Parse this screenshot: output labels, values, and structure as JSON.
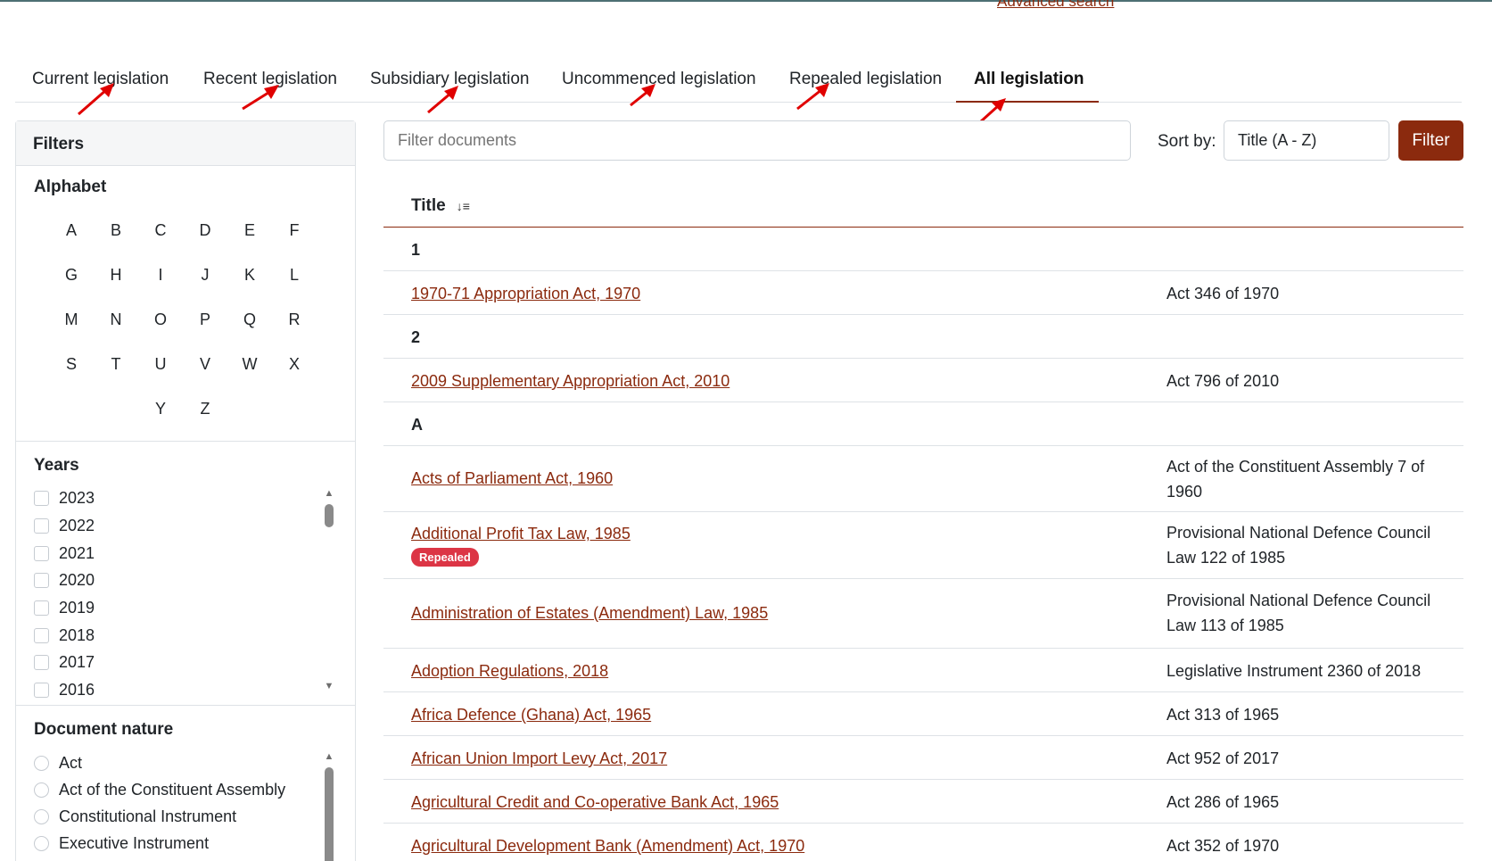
{
  "header": {
    "advanced_search": "Advanced search"
  },
  "tabs": [
    {
      "label": "Current legislation"
    },
    {
      "label": "Recent legislation"
    },
    {
      "label": "Subsidiary legislation"
    },
    {
      "label": "Uncommenced legislation"
    },
    {
      "label": "Repealed legislation"
    },
    {
      "label": "All legislation",
      "active": true
    }
  ],
  "filters": {
    "title": "Filters",
    "alphabet_title": "Alphabet",
    "letters": [
      "A",
      "B",
      "C",
      "D",
      "E",
      "F",
      "G",
      "H",
      "I",
      "J",
      "K",
      "L",
      "M",
      "N",
      "O",
      "P",
      "Q",
      "R",
      "S",
      "T",
      "U",
      "V",
      "W",
      "X",
      "Y",
      "Z"
    ],
    "years_title": "Years",
    "years": [
      "2023",
      "2022",
      "2021",
      "2020",
      "2019",
      "2018",
      "2017",
      "2016"
    ],
    "nature_title": "Document nature",
    "natures": [
      "Act",
      "Act of the Constituent Assembly",
      "Constitutional Instrument",
      "Executive Instrument"
    ]
  },
  "toolbar": {
    "search_placeholder": "Filter documents",
    "sort_label": "Sort by:",
    "sort_value": "Title (A - Z)",
    "filter_button": "Filter"
  },
  "table": {
    "title_header": "Title",
    "groups": {
      "g1": "1",
      "g2": "2",
      "gA": "A"
    },
    "rows": [
      {
        "title": "1970-71 Appropriation Act, 1970",
        "citation": "Act 346 of 1970"
      },
      {
        "title": "2009 Supplementary Appropriation Act, 2010",
        "citation": "Act 796 of 2010"
      },
      {
        "title": "Acts of Parliament Act, 1960",
        "citation": "Act of the Constituent Assembly 7 of 1960"
      },
      {
        "title": "Additional Profit Tax Law, 1985",
        "citation": "Provisional National Defence Council Law 122 of 1985",
        "badge": "Repealed"
      },
      {
        "title": "Administration of Estates (Amendment) Law, 1985",
        "citation": "Provisional National Defence Council Law 113 of 1985"
      },
      {
        "title": "Adoption Regulations, 2018",
        "citation": "Legislative Instrument 2360 of 2018"
      },
      {
        "title": "Africa Defence (Ghana) Act, 1965",
        "citation": "Act 313 of 1965"
      },
      {
        "title": "African Union Import Levy Act, 2017",
        "citation": "Act 952 of 2017"
      },
      {
        "title": "Agricultural Credit and Co-operative Bank Act, 1965",
        "citation": "Act 286 of 1965"
      },
      {
        "title": "Agricultural Development Bank (Amendment) Act, 1970",
        "citation": "Act 352 of 1970"
      }
    ]
  },
  "colors": {
    "accent": "#8b2a0e",
    "badge": "#dc3545",
    "annotation_arrow": "#e00000"
  }
}
